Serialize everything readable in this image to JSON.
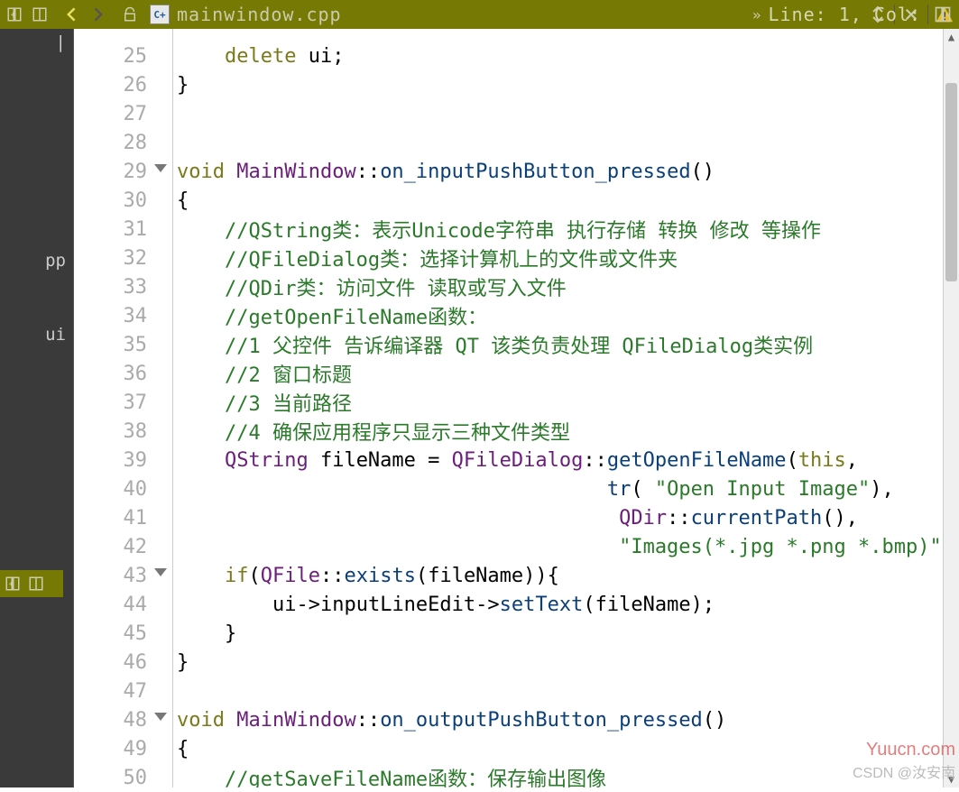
{
  "toolbar": {
    "filename": "mainwindow.cpp",
    "position": "Line: 1, Col:"
  },
  "leftPanel": {
    "item1": "pp",
    "item2": "ui"
  },
  "gutter": {
    "start": 25,
    "end": 50,
    "foldLines": [
      29,
      43,
      48
    ]
  },
  "code": {
    "l25": {
      "indent": "    ",
      "tokens": [
        {
          "c": "k-type",
          "t": "delete "
        },
        {
          "c": "k-ident",
          "t": "ui"
        },
        {
          "c": "k-op",
          "t": ";"
        }
      ]
    },
    "l26": {
      "indent": "",
      "tokens": [
        {
          "c": "k-paren",
          "t": "}"
        }
      ]
    },
    "l27": {
      "indent": "",
      "tokens": []
    },
    "l28": {
      "indent": "",
      "tokens": []
    },
    "l29": {
      "indent": "",
      "tokens": [
        {
          "c": "k-type",
          "t": "void "
        },
        {
          "c": "k-class",
          "t": "MainWindow"
        },
        {
          "c": "k-scope",
          "t": "::"
        },
        {
          "c": "k-func",
          "t": "on_inputPushButton_pressed"
        },
        {
          "c": "k-paren",
          "t": "()"
        }
      ]
    },
    "l30": {
      "indent": "",
      "tokens": [
        {
          "c": "k-paren",
          "t": "{"
        }
      ]
    },
    "l31": {
      "indent": "    ",
      "tokens": [
        {
          "c": "k-comment",
          "t": "//QString类：表示Unicode字符串 执行存储 转换 修改 等操作"
        }
      ]
    },
    "l32": {
      "indent": "    ",
      "tokens": [
        {
          "c": "k-comment",
          "t": "//QFileDialog类：选择计算机上的文件或文件夹"
        }
      ]
    },
    "l33": {
      "indent": "    ",
      "tokens": [
        {
          "c": "k-comment",
          "t": "//QDir类：访问文件 读取或写入文件"
        }
      ]
    },
    "l34": {
      "indent": "    ",
      "tokens": [
        {
          "c": "k-comment",
          "t": "//getOpenFileName函数："
        }
      ]
    },
    "l35": {
      "indent": "    ",
      "tokens": [
        {
          "c": "k-comment",
          "t": "//1 父控件 告诉编译器 QT 该类负责处理 QFileDialog类实例"
        }
      ]
    },
    "l36": {
      "indent": "    ",
      "tokens": [
        {
          "c": "k-comment",
          "t": "//2 窗口标题"
        }
      ]
    },
    "l37": {
      "indent": "    ",
      "tokens": [
        {
          "c": "k-comment",
          "t": "//3 当前路径"
        }
      ]
    },
    "l38": {
      "indent": "    ",
      "tokens": [
        {
          "c": "k-comment",
          "t": "//4 确保应用程序只显示三种文件类型"
        }
      ]
    },
    "l39": {
      "indent": "    ",
      "tokens": [
        {
          "c": "k-class",
          "t": "QString "
        },
        {
          "c": "k-ident",
          "t": "fileName "
        },
        {
          "c": "k-op",
          "t": "= "
        },
        {
          "c": "k-static",
          "t": "QFileDialog"
        },
        {
          "c": "k-scope",
          "t": "::"
        },
        {
          "c": "k-call",
          "t": "getOpenFileName"
        },
        {
          "c": "k-paren",
          "t": "("
        },
        {
          "c": "k-this",
          "t": "this"
        },
        {
          "c": "k-op",
          "t": ","
        }
      ]
    },
    "l40": {
      "indent": "                                    ",
      "tokens": [
        {
          "c": "k-call",
          "t": "tr"
        },
        {
          "c": "k-paren",
          "t": "( "
        },
        {
          "c": "k-str",
          "t": "\"Open Input Image\""
        },
        {
          "c": "k-paren",
          "t": ")"
        },
        {
          "c": "k-op",
          "t": ","
        }
      ]
    },
    "l41": {
      "indent": "                                    ",
      "tokens": [
        {
          "c": "k-paren",
          "t": " "
        },
        {
          "c": "k-static",
          "t": "QDir"
        },
        {
          "c": "k-scope",
          "t": "::"
        },
        {
          "c": "k-call",
          "t": "currentPath"
        },
        {
          "c": "k-paren",
          "t": "()"
        },
        {
          "c": "k-op",
          "t": ","
        }
      ]
    },
    "l42": {
      "indent": "                                    ",
      "tokens": [
        {
          "c": "k-paren",
          "t": " "
        },
        {
          "c": "k-str",
          "t": "\"Images(*.jpg *.png *.bmp)\""
        },
        {
          "c": "k-paren",
          "t": ")"
        },
        {
          "c": "k-op",
          "t": ";"
        }
      ]
    },
    "l43": {
      "indent": "    ",
      "tokens": [
        {
          "c": "k-type",
          "t": "if"
        },
        {
          "c": "k-paren",
          "t": "("
        },
        {
          "c": "k-static",
          "t": "QFile"
        },
        {
          "c": "k-scope",
          "t": "::"
        },
        {
          "c": "k-call",
          "t": "exists"
        },
        {
          "c": "k-paren",
          "t": "("
        },
        {
          "c": "k-ident",
          "t": "fileName"
        },
        {
          "c": "k-paren",
          "t": ")){"
        }
      ]
    },
    "l44": {
      "indent": "        ",
      "tokens": [
        {
          "c": "k-ident",
          "t": "ui"
        },
        {
          "c": "k-op",
          "t": "->"
        },
        {
          "c": "k-ident",
          "t": "inputLineEdit"
        },
        {
          "c": "k-op",
          "t": "->"
        },
        {
          "c": "k-call",
          "t": "setText"
        },
        {
          "c": "k-paren",
          "t": "("
        },
        {
          "c": "k-ident",
          "t": "fileName"
        },
        {
          "c": "k-paren",
          "t": ")"
        },
        {
          "c": "k-op",
          "t": ";"
        }
      ]
    },
    "l45": {
      "indent": "    ",
      "tokens": [
        {
          "c": "k-paren",
          "t": "}"
        }
      ]
    },
    "l46": {
      "indent": "",
      "tokens": [
        {
          "c": "k-paren",
          "t": "}"
        }
      ]
    },
    "l47": {
      "indent": "",
      "tokens": []
    },
    "l48": {
      "indent": "",
      "tokens": [
        {
          "c": "k-type",
          "t": "void "
        },
        {
          "c": "k-class",
          "t": "MainWindow"
        },
        {
          "c": "k-scope",
          "t": "::"
        },
        {
          "c": "k-func",
          "t": "on_outputPushButton_pressed"
        },
        {
          "c": "k-paren",
          "t": "()"
        }
      ]
    },
    "l49": {
      "indent": "",
      "tokens": [
        {
          "c": "k-paren",
          "t": "{"
        }
      ]
    },
    "l50": {
      "indent": "    ",
      "tokens": [
        {
          "c": "k-comment",
          "t": "//getSaveFileName函数：保存输出图像"
        }
      ]
    }
  },
  "watermarks": {
    "site": "Yuucn.com",
    "author": "CSDN @汝安南"
  }
}
